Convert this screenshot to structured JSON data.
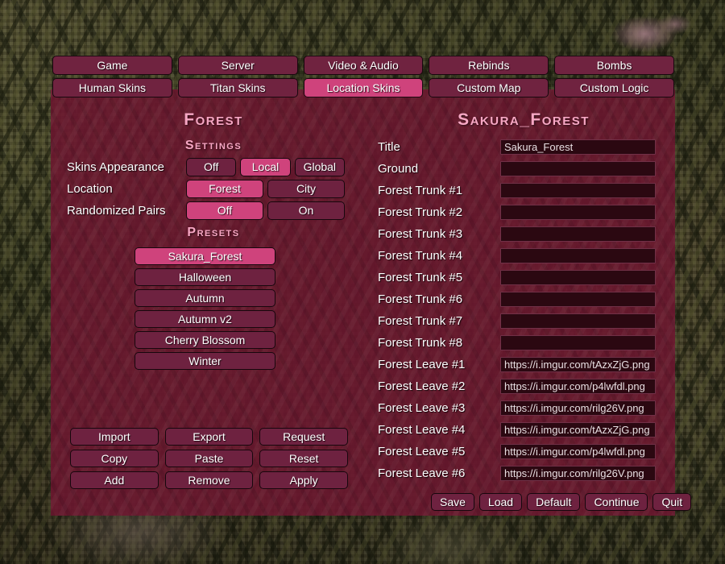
{
  "tabs": {
    "row1": [
      {
        "label": "Game",
        "active": false
      },
      {
        "label": "Server",
        "active": false
      },
      {
        "label": "Video & Audio",
        "active": false
      },
      {
        "label": "Rebinds",
        "active": false
      },
      {
        "label": "Bombs",
        "active": false
      }
    ],
    "row2": [
      {
        "label": "Human Skins",
        "active": false
      },
      {
        "label": "Titan Skins",
        "active": false
      },
      {
        "label": "Location Skins",
        "active": true
      },
      {
        "label": "Custom Map",
        "active": false
      },
      {
        "label": "Custom Logic",
        "active": false
      }
    ]
  },
  "left_panel": {
    "title": "Forest",
    "settings_heading": "Settings",
    "settings": [
      {
        "label": "Skins Appearance",
        "options": [
          "Off",
          "Local",
          "Global"
        ],
        "selected": "Local"
      },
      {
        "label": "Location",
        "options": [
          "Forest",
          "City"
        ],
        "selected": "Forest"
      },
      {
        "label": "Randomized Pairs",
        "options": [
          "Off",
          "On"
        ],
        "selected": "Off"
      }
    ],
    "presets_heading": "Presets",
    "presets": [
      {
        "label": "Sakura_Forest",
        "selected": true
      },
      {
        "label": "Halloween",
        "selected": false
      },
      {
        "label": "Autumn",
        "selected": false
      },
      {
        "label": "Autumn v2",
        "selected": false
      },
      {
        "label": "Cherry Blossom",
        "selected": false
      },
      {
        "label": "Winter",
        "selected": false
      }
    ],
    "actions": [
      "Import",
      "Export",
      "Request",
      "Copy",
      "Paste",
      "Reset",
      "Add",
      "Remove",
      "Apply"
    ]
  },
  "right_panel": {
    "title": "Sakura_Forest",
    "fields": [
      {
        "label": "Title",
        "value": "Sakura_Forest"
      },
      {
        "label": "Ground",
        "value": ""
      },
      {
        "label": "Forest Trunk #1",
        "value": ""
      },
      {
        "label": "Forest Trunk #2",
        "value": ""
      },
      {
        "label": "Forest Trunk #3",
        "value": ""
      },
      {
        "label": "Forest Trunk #4",
        "value": ""
      },
      {
        "label": "Forest Trunk #5",
        "value": ""
      },
      {
        "label": "Forest Trunk #6",
        "value": ""
      },
      {
        "label": "Forest Trunk #7",
        "value": ""
      },
      {
        "label": "Forest Trunk #8",
        "value": ""
      },
      {
        "label": "Forest Leave #1",
        "value": "https://i.imgur.com/tAzxZjG.png"
      },
      {
        "label": "Forest Leave #2",
        "value": "https://i.imgur.com/p4lwfdl.png"
      },
      {
        "label": "Forest Leave #3",
        "value": "https://i.imgur.com/rilg26V.png"
      },
      {
        "label": "Forest Leave #4",
        "value": "https://i.imgur.com/tAzxZjG.png"
      },
      {
        "label": "Forest Leave #5",
        "value": "https://i.imgur.com/p4lwfdl.png"
      },
      {
        "label": "Forest Leave #6",
        "value": "https://i.imgur.com/rilg26V.png"
      }
    ]
  },
  "bottom_bar": [
    "Save",
    "Load",
    "Default",
    "Continue",
    "Quit"
  ],
  "colors": {
    "accent_active": "#cf437c",
    "button_idle": "#6e2240",
    "panel_bg": "#6d1630",
    "heading_text": "#f7a7c4",
    "input_bg": "#2b0811",
    "text": "#ffffff"
  }
}
